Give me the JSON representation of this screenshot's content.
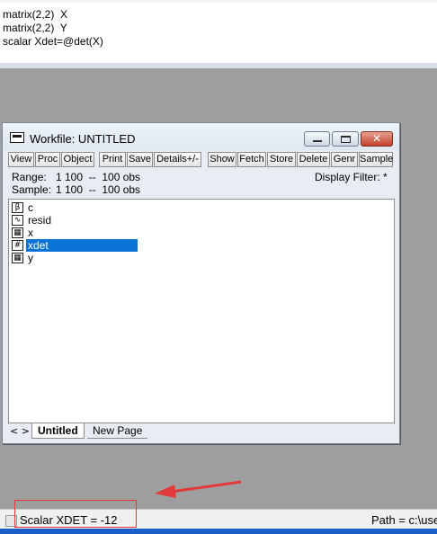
{
  "command_window": {
    "lines": [
      "matrix(2,2)  X",
      "matrix(2,2)  Y",
      "scalar Xdet=@det(X)"
    ]
  },
  "workfile": {
    "title": "Workfile: UNTITLED",
    "toolbar": [
      "View",
      "Proc",
      "Object",
      "Print",
      "Save",
      "Details+/-",
      "Show",
      "Fetch",
      "Store",
      "Delete",
      "Genr",
      "Sample"
    ],
    "range_label": "Range:",
    "range_value": "1 100  --  100 obs",
    "sample_label": "Sample:",
    "sample_value": "1 100  --  100 obs",
    "display_filter": "Display Filter: *",
    "objects": [
      {
        "name": "c",
        "icon": "coefficient-icon",
        "glyph": "β"
      },
      {
        "name": "resid",
        "icon": "series-line-icon",
        "glyph": "∿"
      },
      {
        "name": "x",
        "icon": "matrix-icon",
        "glyph": "▦"
      },
      {
        "name": "xdet",
        "icon": "scalar-icon",
        "glyph": "#",
        "selected": true
      },
      {
        "name": "y",
        "icon": "matrix-icon",
        "glyph": "▦"
      }
    ],
    "tab_nav": "< >",
    "tabs": [
      "Untitled",
      "New Page"
    ]
  },
  "status": {
    "message": "Scalar XDET = -12",
    "path": "Path = c:\\use"
  },
  "colors": {
    "selection": "#0a74d6",
    "annotation": "#e23a3a"
  }
}
